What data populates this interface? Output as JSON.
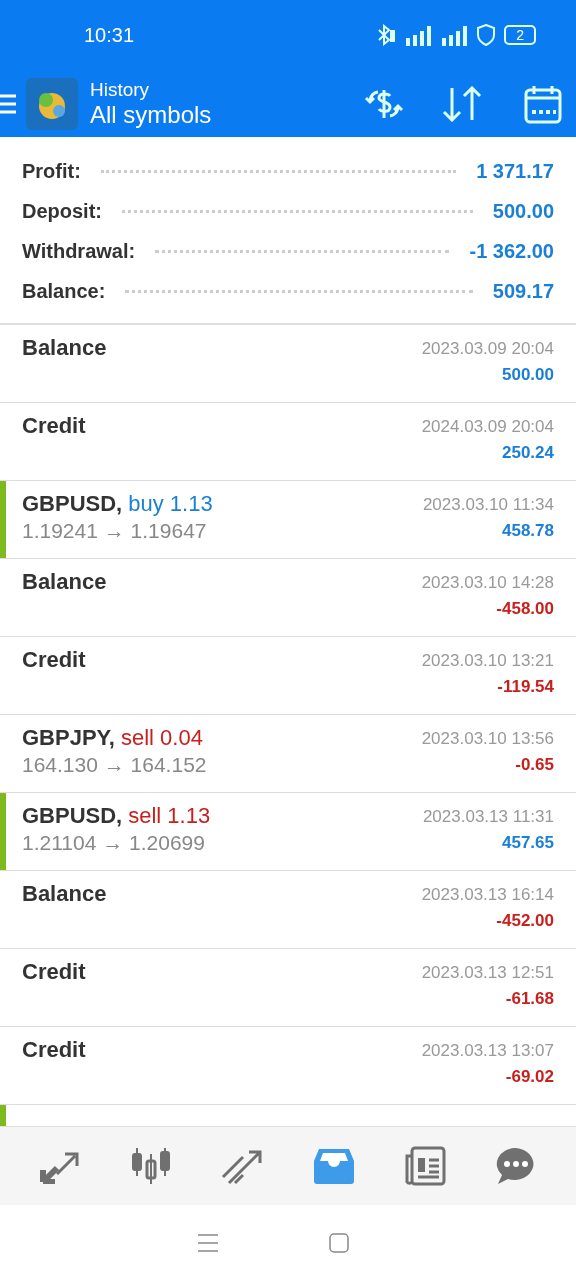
{
  "status_bar": {
    "time": "10:31",
    "battery": "2"
  },
  "header": {
    "title": "History",
    "subtitle": "All symbols"
  },
  "summary": [
    {
      "label": "Profit:",
      "value": "1 371.17"
    },
    {
      "label": "Deposit:",
      "value": "500.00"
    },
    {
      "label": "Withdrawal:",
      "value": "-1 362.00"
    },
    {
      "label": "Balance:",
      "value": "509.17"
    }
  ],
  "rows": [
    {
      "kind": "operation",
      "title": "Balance",
      "date": "2023.03.09 20:04",
      "amount": "500.00",
      "positive": true,
      "marked": false
    },
    {
      "kind": "operation",
      "title": "Credit",
      "date": "2024.03.09 20:04",
      "amount": "250.24",
      "positive": true,
      "marked": false
    },
    {
      "kind": "trade",
      "symbol": "GBPUSD,",
      "side": "buy 1.13",
      "buy": true,
      "prices": "1.19241 → 1.19647",
      "date": "2023.03.10 11:34",
      "amount": "458.78",
      "positive": true,
      "marked": true
    },
    {
      "kind": "operation",
      "title": "Balance",
      "date": "2023.03.10 14:28",
      "amount": "-458.00",
      "positive": false,
      "marked": false
    },
    {
      "kind": "operation",
      "title": "Credit",
      "date": "2023.03.10 13:21",
      "amount": "-119.54",
      "positive": false,
      "marked": false
    },
    {
      "kind": "trade",
      "symbol": "GBPJPY,",
      "side": "sell 0.04",
      "buy": false,
      "prices": "164.130 → 164.152",
      "date": "2023.03.10 13:56",
      "amount": "-0.65",
      "positive": false,
      "marked": false
    },
    {
      "kind": "trade",
      "symbol": "GBPUSD,",
      "side": "sell 1.13",
      "buy": false,
      "prices": "1.21104 → 1.20699",
      "date": "2023.03.13 11:31",
      "amount": "457.65",
      "positive": true,
      "marked": true
    },
    {
      "kind": "operation",
      "title": "Balance",
      "date": "2023.03.13 16:14",
      "amount": "-452.00",
      "positive": false,
      "marked": false
    },
    {
      "kind": "operation",
      "title": "Credit",
      "date": "2023.03.13 12:51",
      "amount": "-61.68",
      "positive": false,
      "marked": false
    },
    {
      "kind": "operation",
      "title": "Credit",
      "date": "2023.03.13 13:07",
      "amount": "-69.02",
      "positive": false,
      "marked": false
    },
    {
      "kind": "cut",
      "marked": true
    }
  ],
  "tabs": [
    {
      "kind": "trade",
      "selected": false
    },
    {
      "kind": "quotes",
      "selected": false
    },
    {
      "kind": "chart",
      "selected": false
    },
    {
      "kind": "history",
      "selected": true
    },
    {
      "kind": "news",
      "selected": false
    },
    {
      "kind": "chat",
      "selected": false
    }
  ]
}
